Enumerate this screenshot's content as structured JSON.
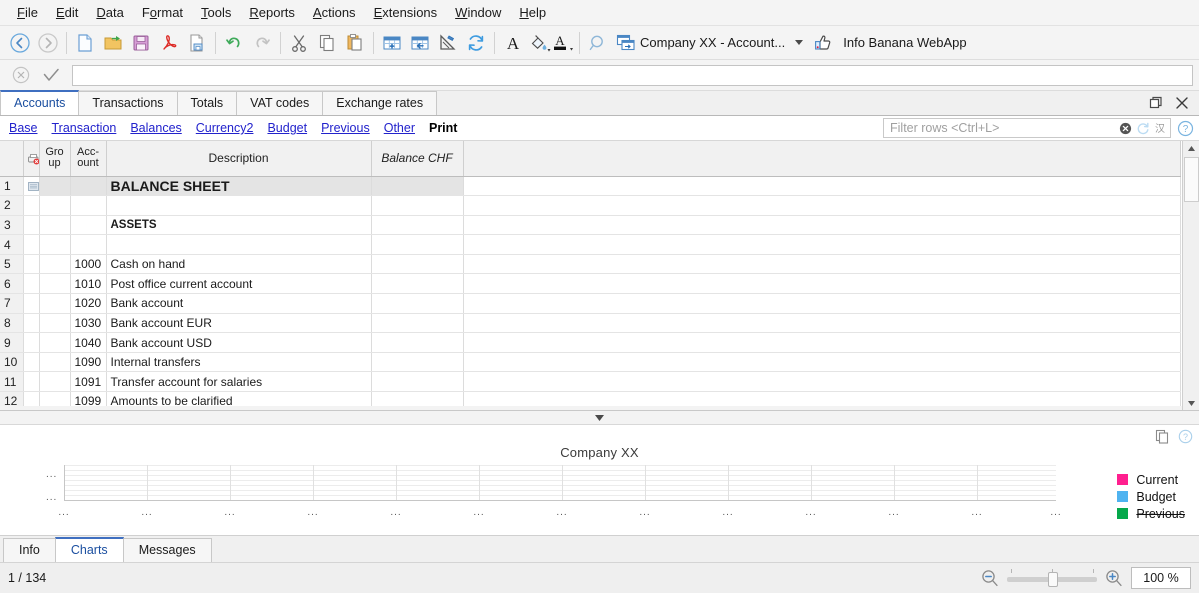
{
  "menu": {
    "items": [
      {
        "label": "File",
        "mnemonic": "F"
      },
      {
        "label": "Edit",
        "mnemonic": "E"
      },
      {
        "label": "Data",
        "mnemonic": "D"
      },
      {
        "label": "Format",
        "mnemonic": "o"
      },
      {
        "label": "Tools",
        "mnemonic": "T"
      },
      {
        "label": "Reports",
        "mnemonic": "R"
      },
      {
        "label": "Actions",
        "mnemonic": "A"
      },
      {
        "label": "Extensions",
        "mnemonic": "E"
      },
      {
        "label": "Window",
        "mnemonic": "W"
      },
      {
        "label": "Help",
        "mnemonic": "H"
      }
    ]
  },
  "toolbar": {
    "icons": [
      "back-icon",
      "forward-icon",
      "new-file-icon",
      "open-folder-icon",
      "save-icon",
      "pdf-export-icon",
      "print-preview-icon",
      "undo-icon",
      "redo-icon",
      "cut-icon",
      "copy-icon",
      "paste-icon",
      "add-row-icon",
      "delete-row-icon",
      "protect-icon",
      "recalculate-icon",
      "font-icon",
      "fill-color-icon",
      "text-color-icon",
      "find-icon"
    ],
    "doc_selector_label": "Company XX - Account...",
    "webapp_label": "Info Banana WebApp",
    "webapp_icon": "thumbs-up-icon"
  },
  "formula_bar": {
    "cancel_icon": "cancel-circle-icon",
    "accept_icon": "checkmark-icon",
    "value": "",
    "placeholder": ""
  },
  "table_tabs": {
    "tabs": [
      {
        "label": "Accounts",
        "active": true
      },
      {
        "label": "Transactions",
        "active": false
      },
      {
        "label": "Totals",
        "active": false
      },
      {
        "label": "VAT codes",
        "active": false
      },
      {
        "label": "Exchange rates",
        "active": false
      }
    ],
    "window_controls": [
      {
        "name": "restore-window-icon"
      },
      {
        "name": "close-window-icon"
      }
    ]
  },
  "views": {
    "links": [
      {
        "label": "Base",
        "current": false
      },
      {
        "label": "Transaction",
        "current": false
      },
      {
        "label": "Balances",
        "current": false
      },
      {
        "label": "Currency2",
        "current": false
      },
      {
        "label": "Budget",
        "current": false
      },
      {
        "label": "Previous",
        "current": false
      },
      {
        "label": "Other",
        "current": false
      },
      {
        "label": "Print",
        "current": true
      }
    ],
    "filter": {
      "placeholder": "Filter rows <Ctrl+L>",
      "value": "",
      "clear_icon": "clear-filter-icon",
      "refresh_icon": "refresh-filter-icon",
      "columns_icon": "filter-settings-icon",
      "help_icon": "help-circle-icon"
    }
  },
  "grid": {
    "columns": [
      {
        "key": "rownum",
        "label": ""
      },
      {
        "key": "mark",
        "label": "",
        "icon": "print-marker-icon"
      },
      {
        "key": "group",
        "label": "Group",
        "label_line1": "Gro",
        "label_line2": "up"
      },
      {
        "key": "account",
        "label": "Account",
        "label_line1": "Acc-",
        "label_line2": "ount"
      },
      {
        "key": "desc",
        "label": "Description"
      },
      {
        "key": "balance",
        "label": "Balance CHF"
      },
      {
        "key": "rest",
        "label": ""
      }
    ],
    "rows": [
      {
        "num": "1",
        "group": "",
        "account": "",
        "desc": "BALANCE SHEET",
        "balance": "",
        "style": "hdr-row"
      },
      {
        "num": "2",
        "group": "",
        "account": "",
        "desc": "",
        "balance": "",
        "style": "blank-row"
      },
      {
        "num": "3",
        "group": "",
        "account": "",
        "desc": "ASSETS",
        "balance": "",
        "style": "sub-row"
      },
      {
        "num": "4",
        "group": "",
        "account": "",
        "desc": "",
        "balance": "",
        "style": "blank-row"
      },
      {
        "num": "5",
        "group": "",
        "account": "1000",
        "desc": "Cash on hand",
        "balance": "",
        "style": ""
      },
      {
        "num": "6",
        "group": "",
        "account": "1010",
        "desc": "Post office current account",
        "balance": "",
        "style": ""
      },
      {
        "num": "7",
        "group": "",
        "account": "1020",
        "desc": "Bank account",
        "balance": "",
        "style": ""
      },
      {
        "num": "8",
        "group": "",
        "account": "1030",
        "desc": "Bank account EUR",
        "balance": "",
        "style": ""
      },
      {
        "num": "9",
        "group": "",
        "account": "1040",
        "desc": "Bank account USD",
        "balance": "",
        "style": ""
      },
      {
        "num": "10",
        "group": "",
        "account": "1090",
        "desc": "Internal transfers",
        "balance": "",
        "style": ""
      },
      {
        "num": "11",
        "group": "",
        "account": "1091",
        "desc": "Transfer account for salaries",
        "balance": "",
        "style": ""
      },
      {
        "num": "12",
        "group": "",
        "account": "1099",
        "desc": "Amounts to be clarified",
        "balance": "",
        "style": "clipped"
      }
    ]
  },
  "splitter": {
    "icon": "collapse-down-icon"
  },
  "chart_panel": {
    "copy_icon": "copy-chart-icon",
    "help_icon": "help-circle-icon"
  },
  "chart_data": {
    "type": "bar",
    "title": "Company XX",
    "xlabel": "",
    "ylabel": "",
    "categories": [
      "...",
      "...",
      "...",
      "...",
      "...",
      "...",
      "...",
      "...",
      "...",
      "...",
      "...",
      "...",
      "..."
    ],
    "series": [
      {
        "name": "Current",
        "color": "#ff1f8f",
        "values": [
          0,
          0,
          0,
          0,
          0,
          0,
          0,
          0,
          0,
          0,
          0,
          0,
          0
        ]
      },
      {
        "name": "Budget",
        "color": "#4fb3f0",
        "values": [
          0,
          0,
          0,
          0,
          0,
          0,
          0,
          0,
          0,
          0,
          0,
          0,
          0
        ]
      },
      {
        "name": "Previous",
        "color": "#05a84b",
        "values": [
          0,
          0,
          0,
          0,
          0,
          0,
          0,
          0,
          0,
          0,
          0,
          0,
          0
        ],
        "hidden": true
      }
    ],
    "ytick_labels": [
      "...",
      "..."
    ],
    "grid": true,
    "legend_position": "right",
    "legend": [
      {
        "label": "Current",
        "color": "#ff1f8f",
        "disabled": false
      },
      {
        "label": "Budget",
        "color": "#4fb3f0",
        "disabled": false
      },
      {
        "label": "Previous",
        "color": "#05a84b",
        "disabled": true
      }
    ]
  },
  "bottom_tabs": {
    "tabs": [
      {
        "label": "Info",
        "active": false
      },
      {
        "label": "Charts",
        "active": true
      },
      {
        "label": "Messages",
        "active": false
      }
    ]
  },
  "status_bar": {
    "page": "1 / 134",
    "zoom_out_icon": "zoom-out-icon",
    "zoom_in_icon": "zoom-in-icon",
    "zoom_level": "100 %"
  }
}
